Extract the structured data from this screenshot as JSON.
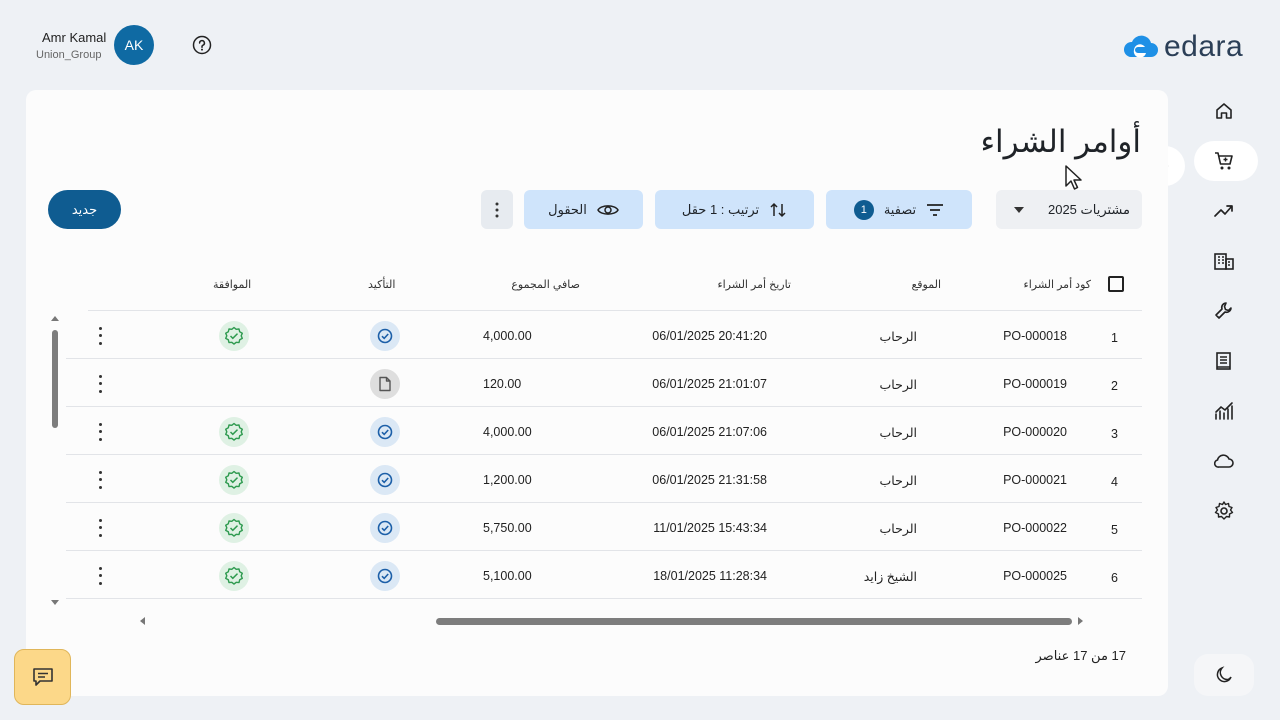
{
  "user": {
    "name": "Amr Kamal",
    "org": "Union_Group",
    "initials": "AK"
  },
  "brand": {
    "name": "edara",
    "accent": "#1e90e6"
  },
  "page": {
    "title": "أوامر الشراء"
  },
  "toolbar": {
    "new_label": "جديد",
    "fields_label": "الحقول",
    "sort_label": "ترتيب : 1 حقل",
    "filter_label": "تصفية",
    "filter_count": "1",
    "period_selected": "مشتريات 2025"
  },
  "table": {
    "headers": {
      "code": "كود أمر الشراء",
      "location": "الموقع",
      "date": "تاريخ أمر الشراء",
      "net_total": "صافي المجموع",
      "confirmation": "التأكيد",
      "approval": "الموافقة"
    },
    "rows": [
      {
        "num": "1",
        "code": "PO-000018",
        "location": "الرحاب",
        "date": "06/01/2025 20:41:20",
        "amount": "4,000.00",
        "confirmation": "confirmed",
        "approval": "approved"
      },
      {
        "num": "2",
        "code": "PO-000019",
        "location": "الرحاب",
        "date": "06/01/2025 21:01:07",
        "amount": "120.00",
        "confirmation": "draft",
        "approval": "none"
      },
      {
        "num": "3",
        "code": "PO-000020",
        "location": "الرحاب",
        "date": "06/01/2025 21:07:06",
        "amount": "4,000.00",
        "confirmation": "confirmed",
        "approval": "approved"
      },
      {
        "num": "4",
        "code": "PO-000021",
        "location": "الرحاب",
        "date": "06/01/2025 21:31:58",
        "amount": "1,200.00",
        "confirmation": "confirmed",
        "approval": "approved"
      },
      {
        "num": "5",
        "code": "PO-000022",
        "location": "الرحاب",
        "date": "11/01/2025 15:43:34",
        "amount": "5,750.00",
        "confirmation": "confirmed",
        "approval": "approved"
      },
      {
        "num": "6",
        "code": "PO-000025",
        "location": "الشيخ زايد",
        "date": "18/01/2025 11:28:34",
        "amount": "5,100.00",
        "confirmation": "confirmed",
        "approval": "approved"
      }
    ]
  },
  "footer": {
    "count_text": "17 من 17 عناصر"
  },
  "nav": {
    "items": [
      "home-icon",
      "cart-icon",
      "trending-icon",
      "building-icon",
      "wrench-icon",
      "ledger-icon",
      "analytics-icon",
      "cloud-icon",
      "settings-icon"
    ],
    "active": "cart-icon"
  },
  "colors": {
    "primary": "#0f5c91",
    "chip": "#cfe4fb",
    "approve": "#2e9a4f",
    "confirm": "#1c5fa8"
  }
}
